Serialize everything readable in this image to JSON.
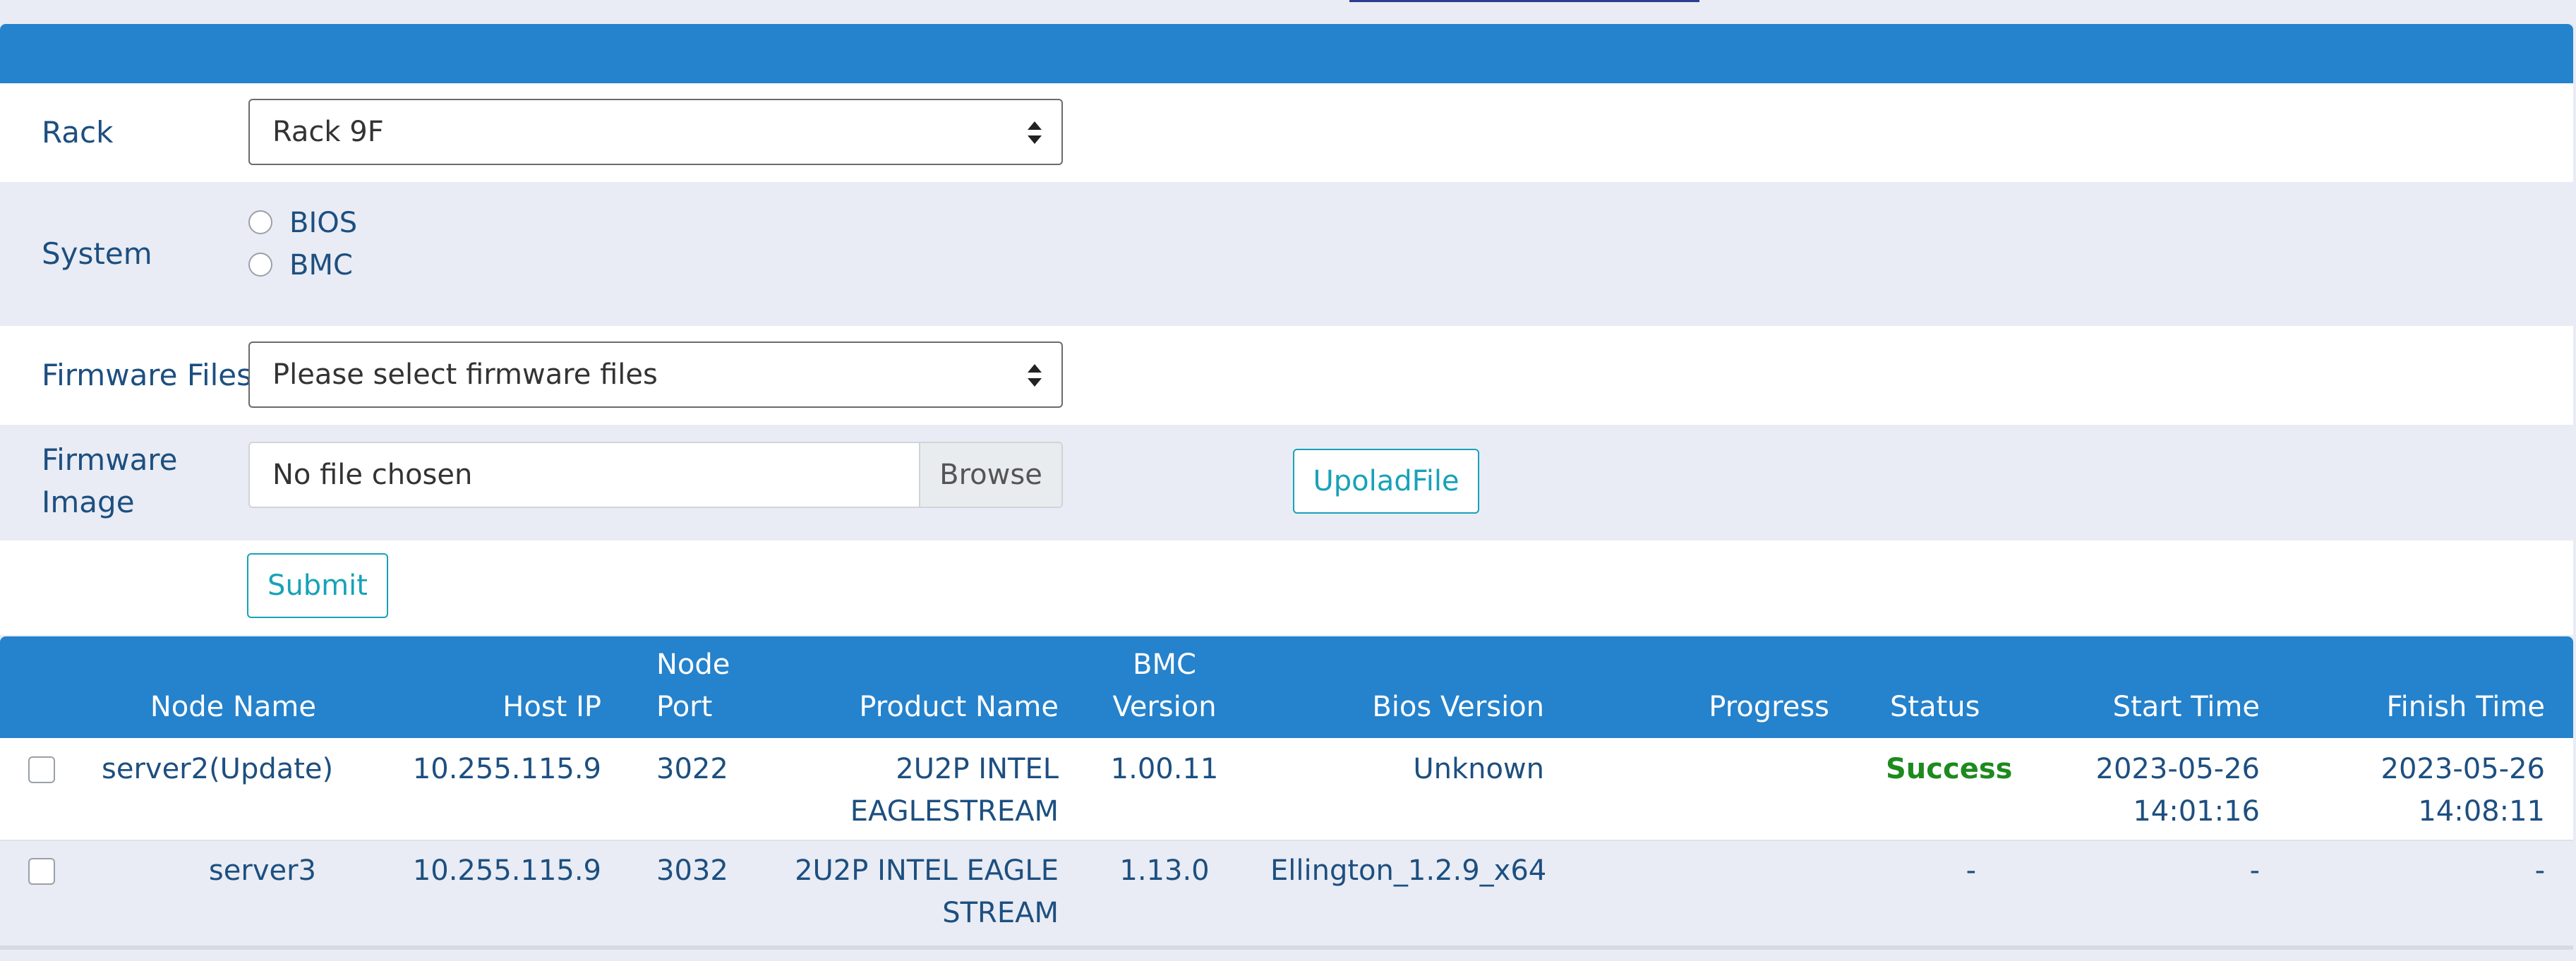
{
  "form": {
    "rack": {
      "label": "Rack",
      "selected": "Rack 9F"
    },
    "system": {
      "label": "System",
      "options": [
        "BIOS",
        "BMC"
      ]
    },
    "firmware_files": {
      "label": "Firmware Files",
      "selected": "Please select firmware files"
    },
    "firmware_image": {
      "label_line1": "Firmware",
      "label_line2": "Image",
      "file_text": "No file chosen",
      "browse_label": "Browse",
      "upload_label": "UpoladFile"
    },
    "submit_label": "Submit"
  },
  "table": {
    "headers": {
      "node_name": "Node Name",
      "host_ip": "Host IP",
      "node_port_1": "Node",
      "node_port_2": "Port",
      "product_name": "Product Name",
      "bmc_version_1": "BMC",
      "bmc_version_2": "Version",
      "bios_version": "Bios Version",
      "progress": "Progress",
      "status": "Status",
      "start_time": "Start Time",
      "finish_time": "Finish Time"
    },
    "rows": [
      {
        "node_name": "server2(Update)",
        "host_ip": "10.255.115.9",
        "node_port": "3022",
        "product_name_1": "2U2P INTEL",
        "product_name_2": "EAGLESTREAM",
        "bmc_version": "1.00.11",
        "bios_version": "Unknown",
        "progress": "",
        "status": "Success",
        "start_time_1": "2023-05-26",
        "start_time_2": "14:01:16",
        "finish_time_1": "2023-05-26",
        "finish_time_2": "14:08:11"
      },
      {
        "node_name": "server3",
        "host_ip": "10.255.115.9",
        "node_port": "3032",
        "product_name_1": "2U2P INTEL EAGLE",
        "product_name_2": "STREAM",
        "bmc_version": "1.13.0",
        "bios_version": "Ellington_1.2.9_x64",
        "progress": "-",
        "status": "",
        "start_time_1": "-",
        "start_time_2": "",
        "finish_time_1": "-",
        "finish_time_2": ""
      }
    ]
  },
  "colors": {
    "header_blue": "#2582cc",
    "label_text": "#1d4f80",
    "success_green": "#1e8a1e",
    "outline_button": "#17a2b8"
  }
}
